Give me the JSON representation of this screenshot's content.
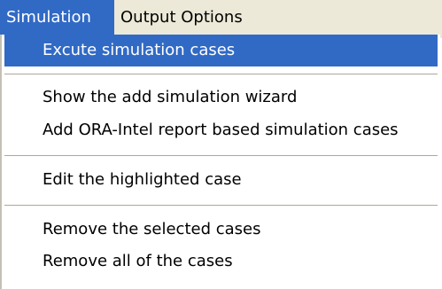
{
  "menubar": {
    "items": [
      {
        "label": "Simulation",
        "active": true
      },
      {
        "label": "Output Options",
        "active": false
      }
    ]
  },
  "simulation_menu": {
    "items": [
      {
        "label": "Excute simulation cases",
        "highlighted": true
      },
      {
        "label": "Show the add simulation wizard",
        "highlighted": false
      },
      {
        "label": "Add ORA-Intel report based simulation cases",
        "highlighted": false
      },
      {
        "label": "Edit the highlighted case",
        "highlighted": false
      },
      {
        "label": "Remove the selected cases",
        "highlighted": false
      },
      {
        "label": "Remove all of the cases",
        "highlighted": false
      }
    ]
  },
  "colors": {
    "menubar_bg": "#ece9d8",
    "highlight": "#316ac5",
    "highlight_text": "#ffffff",
    "menu_bg": "#ffffff",
    "separator": "#aca899"
  }
}
